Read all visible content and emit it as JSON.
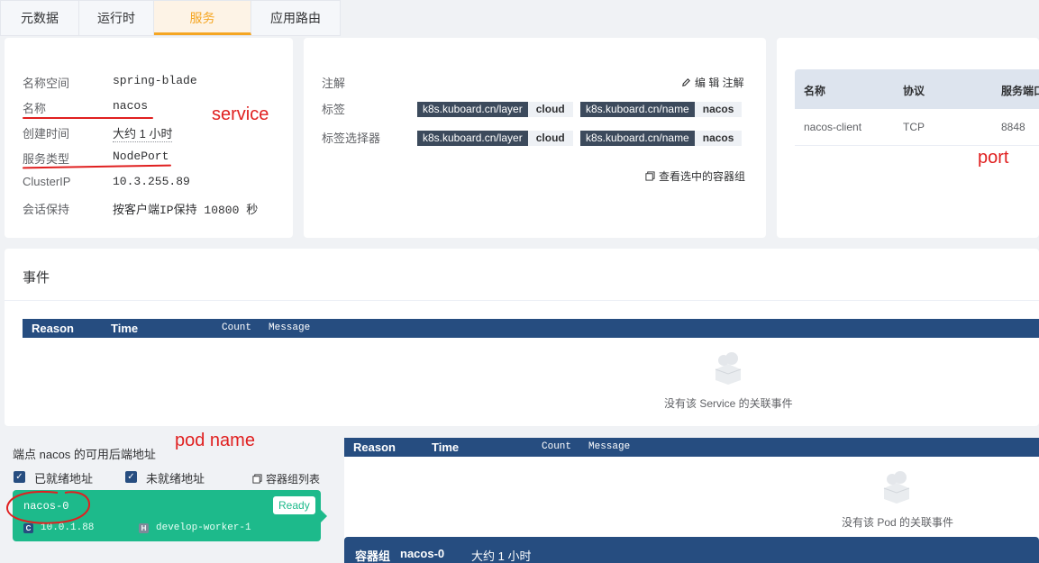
{
  "tabs": [
    "元数据",
    "运行时",
    "服务",
    "应用路由"
  ],
  "service": {
    "namespace_label": "名称空间",
    "namespace": "spring-blade",
    "name_label": "名称",
    "name": "nacos",
    "created_label": "创建时间",
    "created": "大约 1 小时",
    "type_label": "服务类型",
    "type": "NodePort",
    "cluster_ip_label": "ClusterIP",
    "cluster_ip": "10.3.255.89",
    "session_label": "会话保持",
    "session": "按客户端IP保持 10800 秒"
  },
  "annotations": {
    "notes_label": "注解",
    "edit_notes": "编 辑 注解",
    "labels_label": "标签",
    "selector_label": "标签选择器",
    "labels": [
      {
        "key": "k8s.kuboard.cn/layer",
        "value": "cloud"
      },
      {
        "key": "k8s.kuboard.cn/name",
        "value": "nacos"
      }
    ],
    "selectors": [
      {
        "key": "k8s.kuboard.cn/layer",
        "value": "cloud"
      },
      {
        "key": "k8s.kuboard.cn/name",
        "value": "nacos"
      }
    ],
    "view_pods": "查看选中的容器组"
  },
  "ports": {
    "headers": [
      "名称",
      "协议",
      "服务端口"
    ],
    "row": [
      "nacos-client",
      "TCP",
      "8848"
    ]
  },
  "events": {
    "title": "事件",
    "headers": [
      "Reason",
      "Time",
      "Count",
      "Message"
    ],
    "empty": "没有该 Service 的关联事件"
  },
  "endpoints": {
    "title": "端点 nacos 的可用后端地址",
    "ready_label": "已就绪地址",
    "not_ready_label": "未就绪地址",
    "pod_list": "容器组列表",
    "pod_name": "nacos-0",
    "pod_status": "Ready",
    "pod_ip": "10.0.1.88",
    "pod_node": "develop-worker-1",
    "ip_badge": "C",
    "node_badge": "H"
  },
  "pod_events": {
    "headers": [
      "Reason",
      "Time",
      "Count",
      "Message"
    ],
    "empty": "没有该 Pod 的关联事件"
  },
  "pod_bar": {
    "label": "容器组",
    "name": "nacos-0",
    "age": "大约 1 小时"
  },
  "overlay_annotations": {
    "service": "service",
    "port": "port",
    "pod_name": "pod name"
  },
  "colors": {
    "accent": "#f5a623",
    "table_header": "#264d80",
    "pod_green": "#1dba8b",
    "annotation_red": "#e02020"
  }
}
